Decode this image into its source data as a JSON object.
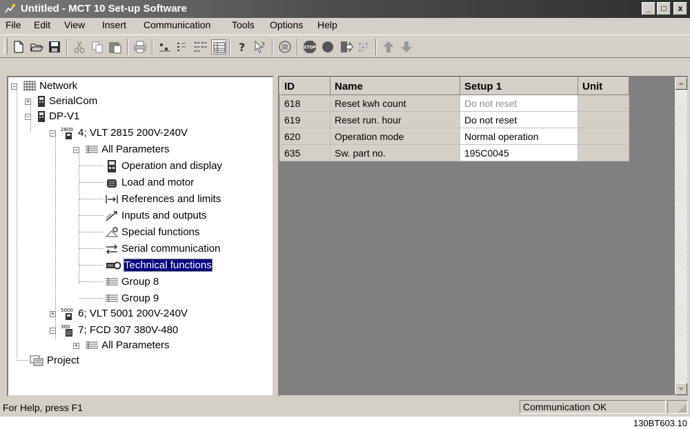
{
  "window": {
    "title": "Untitled - MCT 10 Set-up Software",
    "controls": {
      "minimize": "_",
      "maximize": "□",
      "close": "x"
    }
  },
  "menu": [
    "File",
    "Edit",
    "View",
    "Insert",
    "Communication",
    "Tools",
    "Options",
    "Help"
  ],
  "toolbar": {
    "buttons": [
      "new-document-icon",
      "open-folder-icon",
      "save-icon",
      "cut-icon",
      "copy-icon",
      "paste-icon",
      "print-icon",
      "large-icons-view-icon",
      "small-icons-view-icon",
      "list-view-icon",
      "details-view-icon",
      "help-icon",
      "context-help-icon",
      "network-scan-icon",
      "stop-icon",
      "record-icon",
      "read-from-drive-icon",
      "write-to-drive-icon",
      "arrow-up-icon",
      "arrow-down-icon"
    ]
  },
  "tree": {
    "items": [
      {
        "label": "Network",
        "icon": "network-grid-icon"
      },
      {
        "label": "SerialCom",
        "icon": "drive-icon"
      },
      {
        "label": "DP-V1",
        "icon": "drive-icon"
      },
      {
        "label": "4; VLT 2815 200V-240V",
        "icon": "vlt-2800-icon",
        "icon_text": "2800"
      },
      {
        "label": "All Parameters",
        "icon": "parameter-list-icon"
      },
      {
        "label": "Operation and display",
        "icon": "operation-display-icon"
      },
      {
        "label": "Load and motor",
        "icon": "load-motor-icon"
      },
      {
        "label": "References and limits",
        "icon": "references-limits-icon"
      },
      {
        "label": "Inputs and outputs",
        "icon": "inputs-outputs-icon"
      },
      {
        "label": "Special functions",
        "icon": "special-functions-icon"
      },
      {
        "label": "Serial communication",
        "icon": "serial-communication-icon"
      },
      {
        "label": "Technical functions",
        "icon": "technical-functions-icon"
      },
      {
        "label": "Group 8",
        "icon": "parameter-list-icon"
      },
      {
        "label": "Group 9",
        "icon": "parameter-list-icon"
      },
      {
        "label": "6; VLT 5001 200V-240V",
        "icon": "vlt-5000-icon",
        "icon_text": "5000"
      },
      {
        "label": "7; FCD 307 380V-480",
        "icon": "fcd-300-icon",
        "icon_text": "300"
      },
      {
        "label": "All Parameters",
        "icon": "parameter-list-icon"
      },
      {
        "label": "Project",
        "icon": "project-icon"
      }
    ],
    "selected_label": "Technical functions"
  },
  "grid": {
    "headers": {
      "id": "ID",
      "name": "Name",
      "setup": "Setup 1",
      "unit": "Unit"
    },
    "rows": [
      {
        "id": "618",
        "name": "Reset kwh count",
        "setup": "Do not reset",
        "unit": "",
        "disabled": true
      },
      {
        "id": "619",
        "name": "Reset run. hour",
        "setup": "Do not reset",
        "unit": "",
        "disabled": false
      },
      {
        "id": "620",
        "name": "Operation mode",
        "setup": "Normal operation",
        "unit": "",
        "disabled": false
      },
      {
        "id": "635",
        "name": "Sw. part no.",
        "setup": "195C0045",
        "unit": "",
        "disabled": false
      }
    ]
  },
  "status": {
    "help": "For Help, press F1",
    "communication": "Communication OK"
  },
  "figure_code": "130BT603.10",
  "colors": {
    "selection": "#000080",
    "grid_background": "#808080",
    "chrome": "#d4d0c8"
  }
}
